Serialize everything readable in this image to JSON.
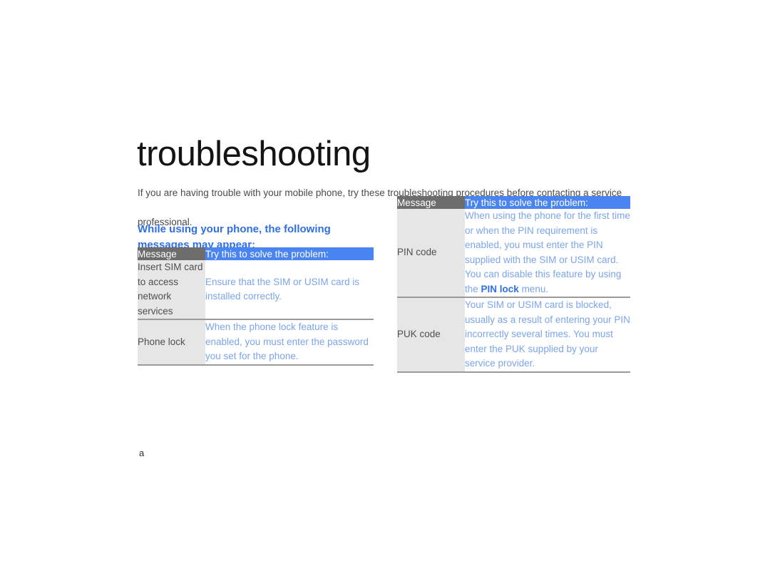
{
  "document": {
    "title": "troubleshooting",
    "intro": "If you are having trouble with your mobile phone, try these troubleshooting procedures before contacting a service professional.",
    "page_marker": "a"
  },
  "section": {
    "heading": "While using your phone, the following messages may appear:"
  },
  "colors": {
    "heading_blue": "#2f6fe4",
    "body_blue": "#7ba4ec",
    "header_gray": "#6d6d6d",
    "header_blue": "#4a84f0",
    "message_cell_gray": "#e6e6e6",
    "rule_gray": "#9a9a9a",
    "title_black": "#141414"
  },
  "table_left": {
    "headers": {
      "message": "Message",
      "solution": "Try this to solve the problem:"
    },
    "rows": [
      {
        "message": "Insert SIM card to access network services",
        "solution": "Ensure that the SIM or USIM card is installed correctly."
      },
      {
        "message": "Phone lock",
        "solution": "When the phone lock feature is enabled, you must enter the password you set for the phone."
      }
    ]
  },
  "table_right": {
    "headers": {
      "message": "Message",
      "solution": "Try this to solve the problem:"
    },
    "rows": [
      {
        "message": "PIN code",
        "solution_pre": "When using the phone for the first time or when the PIN requirement is enabled, you must enter the PIN supplied with the SIM or USIM card. You can disable this feature by using the ",
        "solution_emphasis": "PIN lock",
        "solution_post": " menu."
      },
      {
        "message": "PUK code",
        "solution": "Your SIM or USIM card is blocked, usually as a result of entering your PIN incorrectly several times. You must enter the PUK supplied by your service provider."
      }
    ]
  }
}
